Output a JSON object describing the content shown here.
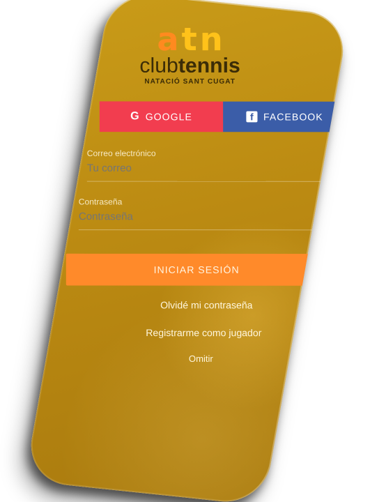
{
  "logo": {
    "letters": [
      "a",
      "t",
      "n"
    ],
    "wordmark_light": "club",
    "wordmark_bold": "tennis",
    "subtitle": "NATACIÓ SANT CUGAT"
  },
  "social": {
    "google_icon": "G",
    "google_label": "GOOGLE",
    "facebook_icon": "f",
    "facebook_label": "FACEBOOK"
  },
  "form": {
    "email_label": "Correo electrónico",
    "email_placeholder": "Tu correo",
    "password_label": "Contraseña",
    "password_placeholder": "Contraseña"
  },
  "actions": {
    "login_label": "INICIAR SESIÓN",
    "forgot_label": "Olvidé mi contraseña",
    "register_label": "Registrarme como jugador",
    "skip_label": "Omitir"
  },
  "colors": {
    "background": "#bb8a12",
    "google": "#f23d4f",
    "facebook": "#3b5da8",
    "primary": "#ff8a2a",
    "logo_orange": "#ff8a1f",
    "logo_yellow": "#ffc21a"
  }
}
